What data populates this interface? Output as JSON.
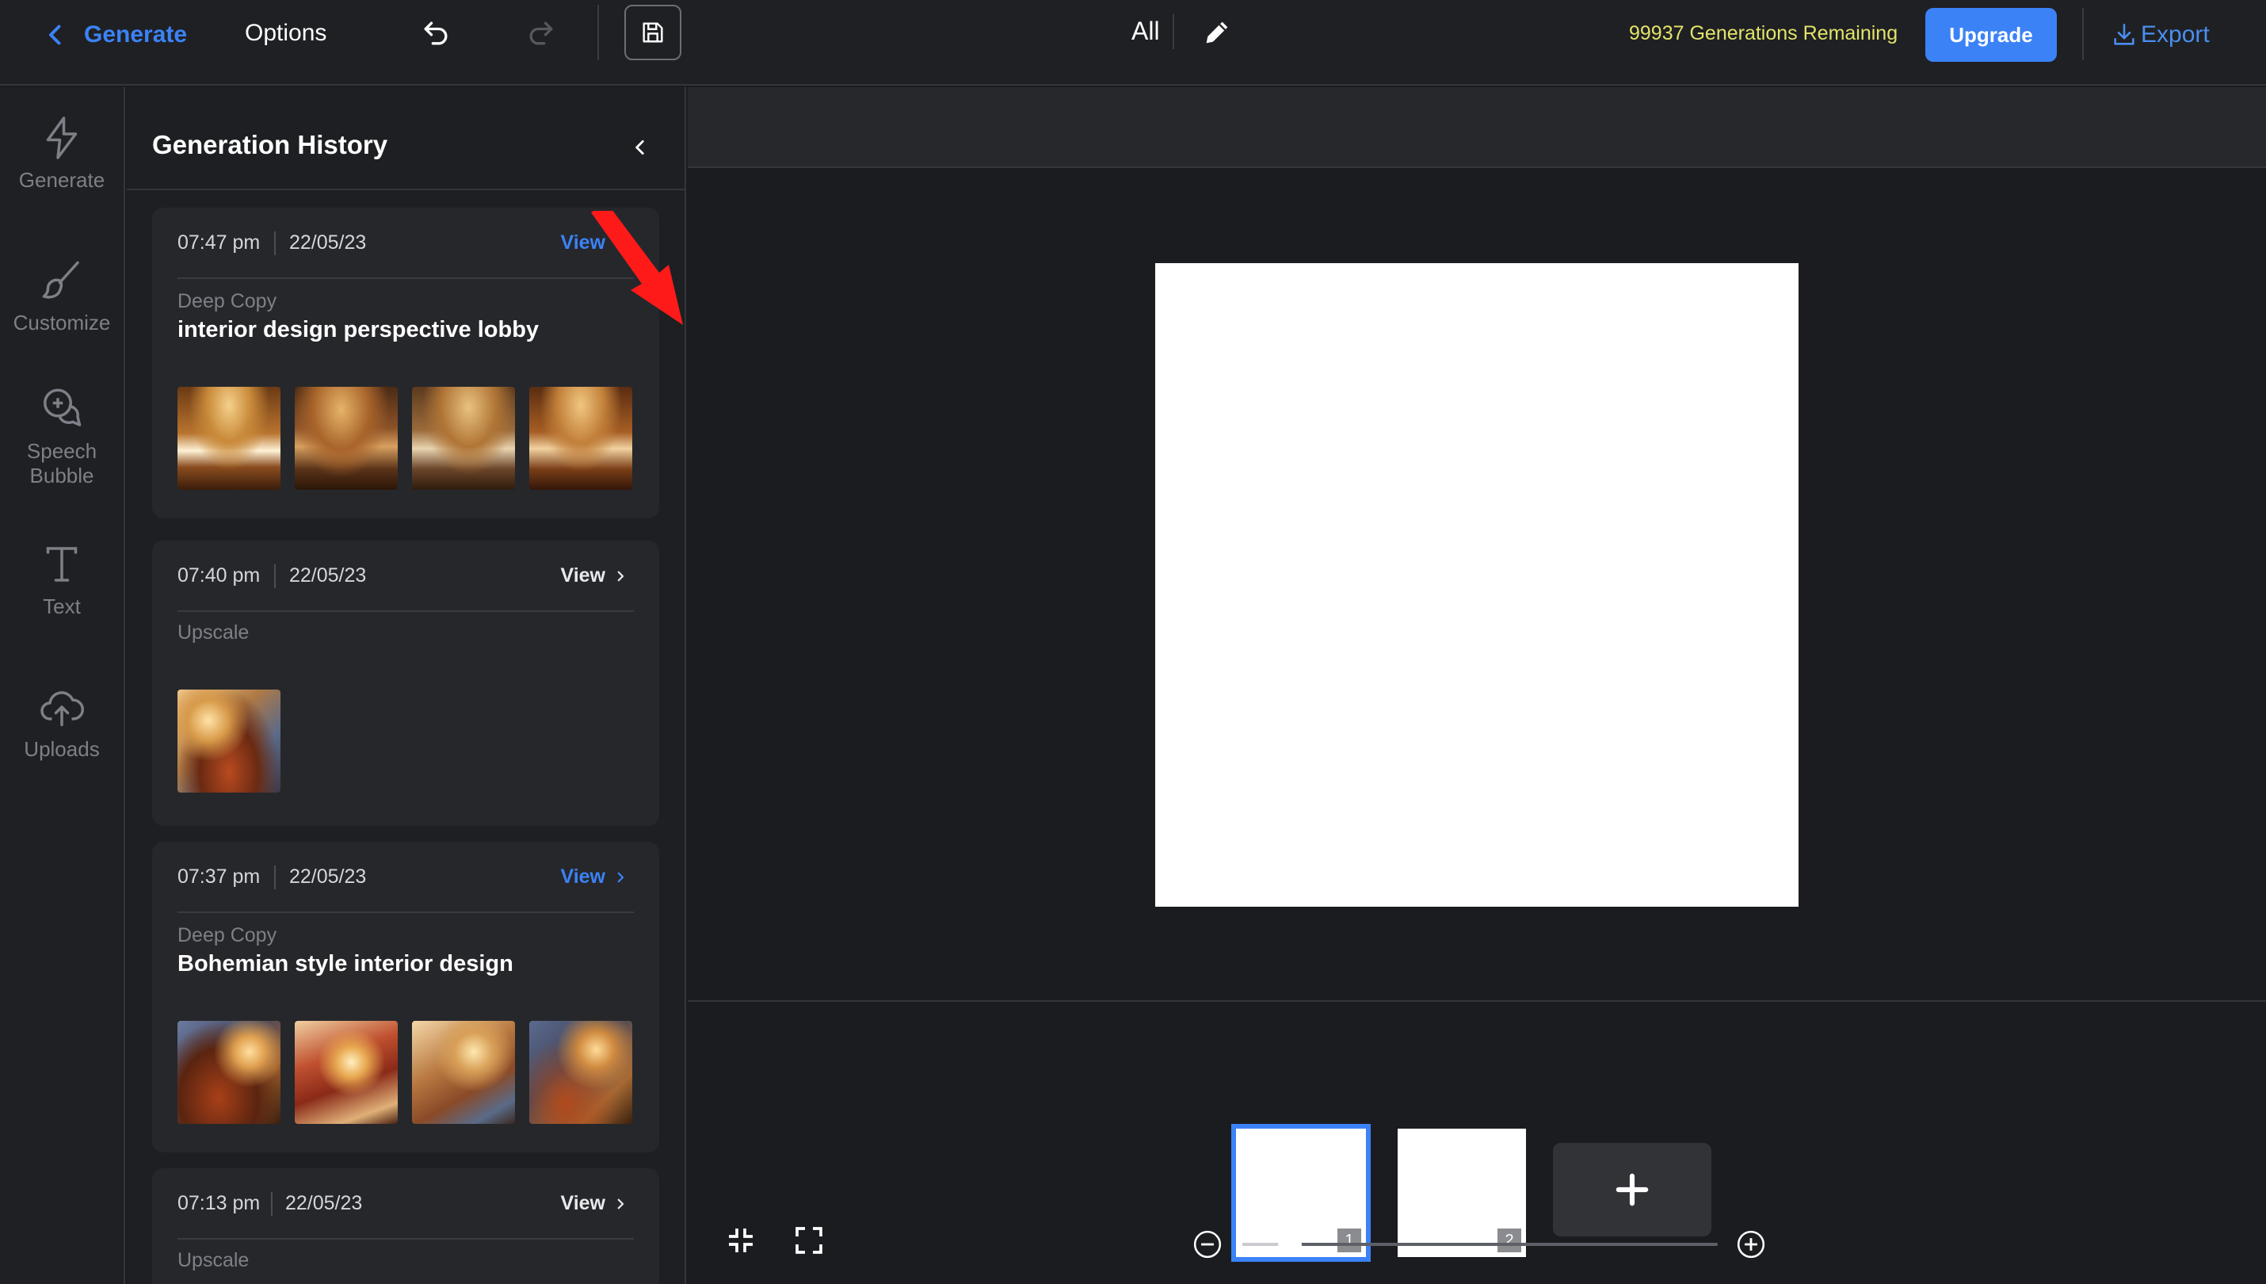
{
  "topbar": {
    "back_label": "Generate",
    "options_label": "Options",
    "all_label": "All",
    "generations_remaining": "99937 Generations Remaining",
    "upgrade_label": "Upgrade",
    "export_label": "Export"
  },
  "rail": {
    "items": [
      {
        "label": "Generate",
        "icon": "lightning-icon"
      },
      {
        "label": "Customize",
        "icon": "brush-icon"
      },
      {
        "label": "Speech Bubble",
        "icon": "speech-bubble-icon"
      },
      {
        "label": "Text",
        "icon": "text-icon"
      },
      {
        "label": "Uploads",
        "icon": "cloud-upload-icon"
      }
    ]
  },
  "history": {
    "title": "Generation History",
    "cards": [
      {
        "time": "07:47 pm",
        "date": "22/05/23",
        "view": "View",
        "view_color": "blue",
        "type": "Deep Copy",
        "prompt": "interior design perspective lobby",
        "thumb_count": 4
      },
      {
        "time": "07:40 pm",
        "date": "22/05/23",
        "view": "View",
        "view_color": "white",
        "type": "Upscale",
        "prompt": "",
        "thumb_count": 1
      },
      {
        "time": "07:37 pm",
        "date": "22/05/23",
        "view": "View",
        "view_color": "blue",
        "type": "Deep Copy",
        "prompt": "Bohemian style interior design",
        "thumb_count": 4
      },
      {
        "time": "07:13 pm",
        "date": "22/05/23",
        "view": "View",
        "view_color": "white",
        "type": "Upscale",
        "prompt": "",
        "thumb_count": 0
      }
    ]
  },
  "canvas": {
    "pages": [
      {
        "number": "1",
        "selected": true
      },
      {
        "number": "2",
        "selected": false
      }
    ],
    "add_page_label": "+",
    "zoom_fraction": 0.1
  },
  "colors": {
    "accent": "#3b82f6",
    "remaining_text": "#e3e36a",
    "annotation_arrow": "#ff1a1a"
  }
}
